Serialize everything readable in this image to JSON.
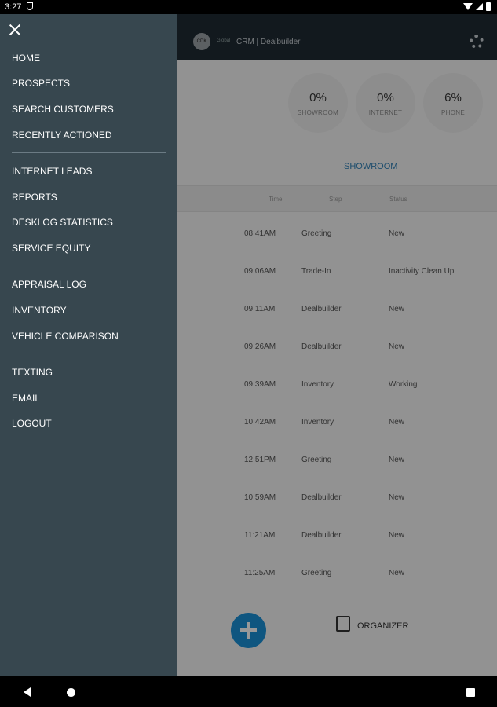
{
  "status": {
    "time": "3:27"
  },
  "app": {
    "logo_text": "CDK",
    "small_text": "Global",
    "title": "CRM | Dealbuilder",
    "stats": [
      {
        "value": "0%",
        "label": "SHOWROOM"
      },
      {
        "value": "0%",
        "label": "INTERNET"
      },
      {
        "value": "6%",
        "label": "PHONE"
      }
    ],
    "active_tab": "SHOWROOM",
    "columns": {
      "time": "Time",
      "step": "Step",
      "status": "Status"
    },
    "rows": [
      {
        "time": "08:41AM",
        "step": "Greeting",
        "status": "New"
      },
      {
        "time": "09:06AM",
        "step": "Trade-In",
        "status": "Inactivity Clean Up"
      },
      {
        "time": "09:11AM",
        "step": "Dealbuilder",
        "status": "New"
      },
      {
        "time": "09:26AM",
        "step": "Dealbuilder",
        "status": "New"
      },
      {
        "time": "09:39AM",
        "step": "Inventory",
        "status": "Working"
      },
      {
        "time": "10:42AM",
        "step": "Inventory",
        "status": "New"
      },
      {
        "time": "12:51PM",
        "step": "Greeting",
        "status": "New"
      },
      {
        "time": "10:59AM",
        "step": "Dealbuilder",
        "status": "New"
      },
      {
        "time": "11:21AM",
        "step": "Dealbuilder",
        "status": "New"
      },
      {
        "time": "11:25AM",
        "step": "Greeting",
        "status": "New"
      }
    ],
    "organizer_label": "ORGANIZER"
  },
  "drawer": {
    "items": [
      "HOME",
      "PROSPECTS",
      "SEARCH CUSTOMERS",
      "RECENTLY ACTIONED",
      "INTERNET LEADS",
      "REPORTS",
      "DESKLOG STATISTICS",
      "SERVICE EQUITY",
      "APPRAISAL LOG",
      "INVENTORY",
      "VEHICLE COMPARISON",
      "TEXTING",
      "EMAIL",
      "LOGOUT"
    ]
  },
  "colors": {
    "drawer_bg": "#37474f",
    "header_bg": "#1f2a33",
    "accent": "#1a8fd6"
  }
}
